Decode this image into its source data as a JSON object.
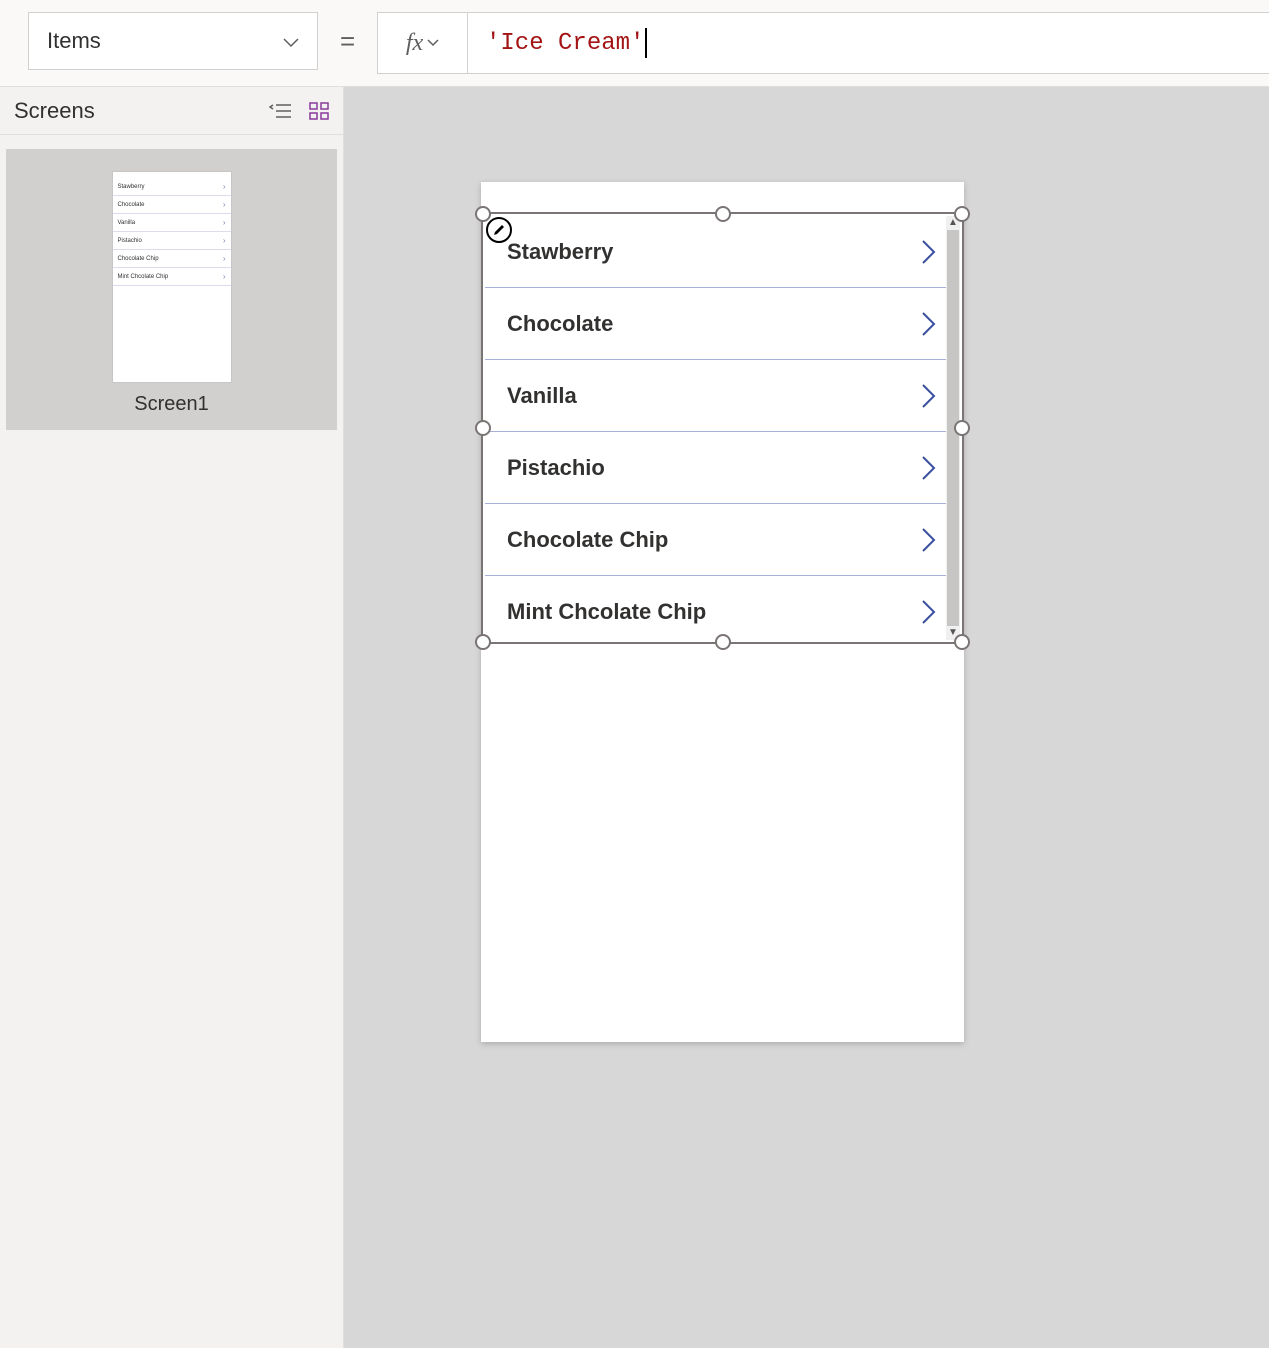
{
  "property_dropdown": {
    "selected": "Items"
  },
  "formula": {
    "value": "'Ice Cream'"
  },
  "tree_panel": {
    "title": "Screens"
  },
  "thumbnail": {
    "label": "Screen1",
    "rows": [
      "Stawberry",
      "Chocolate",
      "Vanilla",
      "Pistachio",
      "Chocolate Chip",
      "Mint Chcolate Chip"
    ]
  },
  "gallery": {
    "items": [
      {
        "label": "Stawberry"
      },
      {
        "label": "Chocolate"
      },
      {
        "label": "Vanilla"
      },
      {
        "label": "Pistachio"
      },
      {
        "label": "Chocolate Chip"
      },
      {
        "label": "Mint Chcolate Chip"
      }
    ]
  }
}
